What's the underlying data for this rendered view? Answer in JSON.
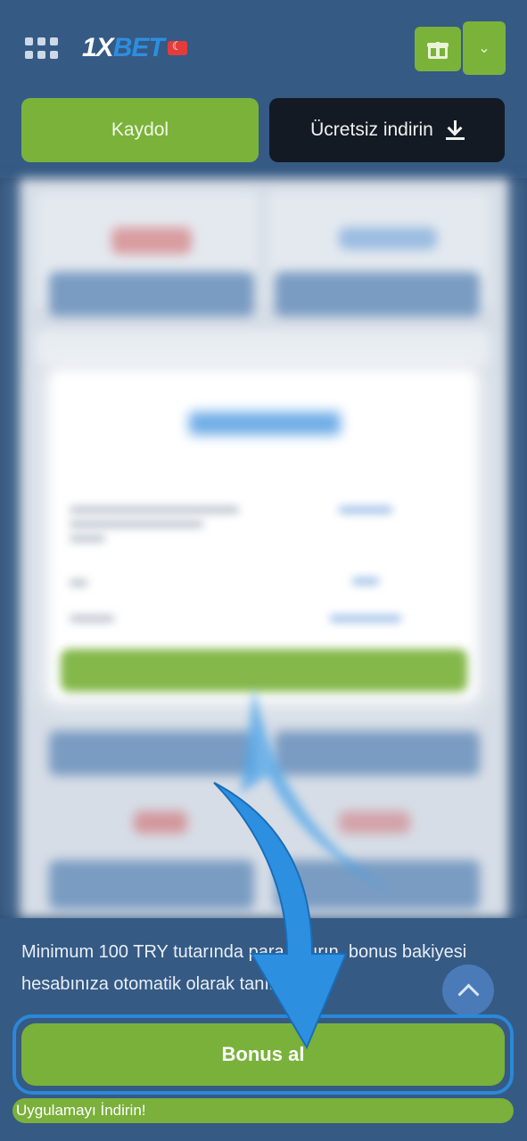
{
  "header": {
    "logo_prefix": "1X",
    "logo_suffix": "BET",
    "menu_icon": "grid-icon",
    "gift_icon": "gift-icon",
    "dropdown_icon": "chevron-down-icon"
  },
  "actions": {
    "register_label": "Kaydol",
    "download_label": "Ücretsiz indirin"
  },
  "promo": {
    "text": "Minimum 100 TRY tutarında para yatırın, bonus bakiyesi hesabınıza otomatik olarak tanımlanır"
  },
  "bonus_button": {
    "label": "Bonus al"
  },
  "app_bar": {
    "label": "Uygulamayı İndirin!"
  },
  "colors": {
    "accent_green": "#7bb33a",
    "header_blue": "#355a84",
    "arrow_blue": "#2b88d8"
  }
}
